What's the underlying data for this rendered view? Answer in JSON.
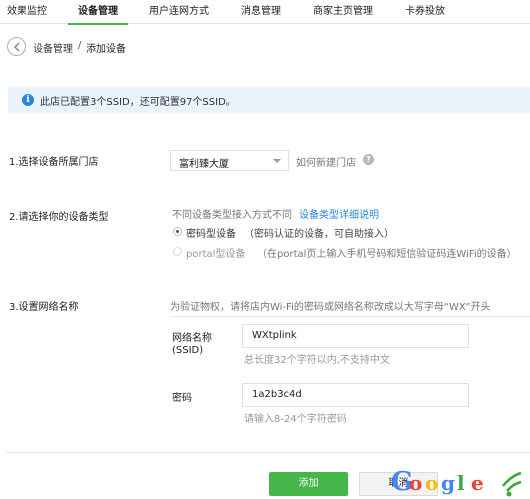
{
  "topnav": {
    "tabs": [
      {
        "label": "效果监控"
      },
      {
        "label": "设备管理"
      },
      {
        "label": "用户连网方式"
      },
      {
        "label": "消息管理"
      },
      {
        "label": "商家主页管理"
      },
      {
        "label": "卡券投放"
      }
    ],
    "active_index": 1
  },
  "breadcrumb": {
    "parent": "设备管理",
    "separator": "/",
    "current": "添加设备"
  },
  "notice": {
    "icon": "info-icon",
    "icon_glyph": "i",
    "text": "此店已配置3个SSID，还可配置97个SSID。"
  },
  "step1": {
    "label": "1.选择设备所属门店",
    "store_value": "富利臻大厦",
    "new_store_link": "如何新建门店",
    "help_glyph": "?"
  },
  "step2": {
    "label": "2.请选择你的设备类型",
    "hint": "不同设备类型接入方式不同",
    "detail_link": "设备类型详细说明",
    "options": [
      {
        "name": "密码型设备",
        "desc": "（密码认证的设备，可自助接入）",
        "checked": true,
        "disabled": false
      },
      {
        "name": "portal型设备",
        "desc": "（在portal页上输入手机号码和短信验证码连WiFi的设备）",
        "checked": false,
        "disabled": true
      }
    ]
  },
  "step3": {
    "label": "3.设置网络名称",
    "hint": "为验证物权，请将店内Wi-Fi的密码或网络名称改成以大写字母“WX”开头",
    "ssid_label_line1": "网络名称",
    "ssid_label_line2": "(SSID)",
    "ssid_value": "WXtplink",
    "ssid_tip": "总长度32个字符以内,不支持中文",
    "password_label": "密码",
    "password_value": "1a2b3c4d",
    "password_tip": "请输入8-24个字符密码"
  },
  "actions": {
    "add_label": "添加",
    "cancel_label": "取消"
  },
  "watermark": {
    "text": "Google",
    "colors": [
      "#4285f4",
      "#ea4335",
      "#fbbc05",
      "#4285f4",
      "#34a853",
      "#ea4335"
    ]
  },
  "colors": {
    "accent": "#44b549",
    "link": "#2b86d8",
    "notice_bg": "#eaf3fb"
  }
}
